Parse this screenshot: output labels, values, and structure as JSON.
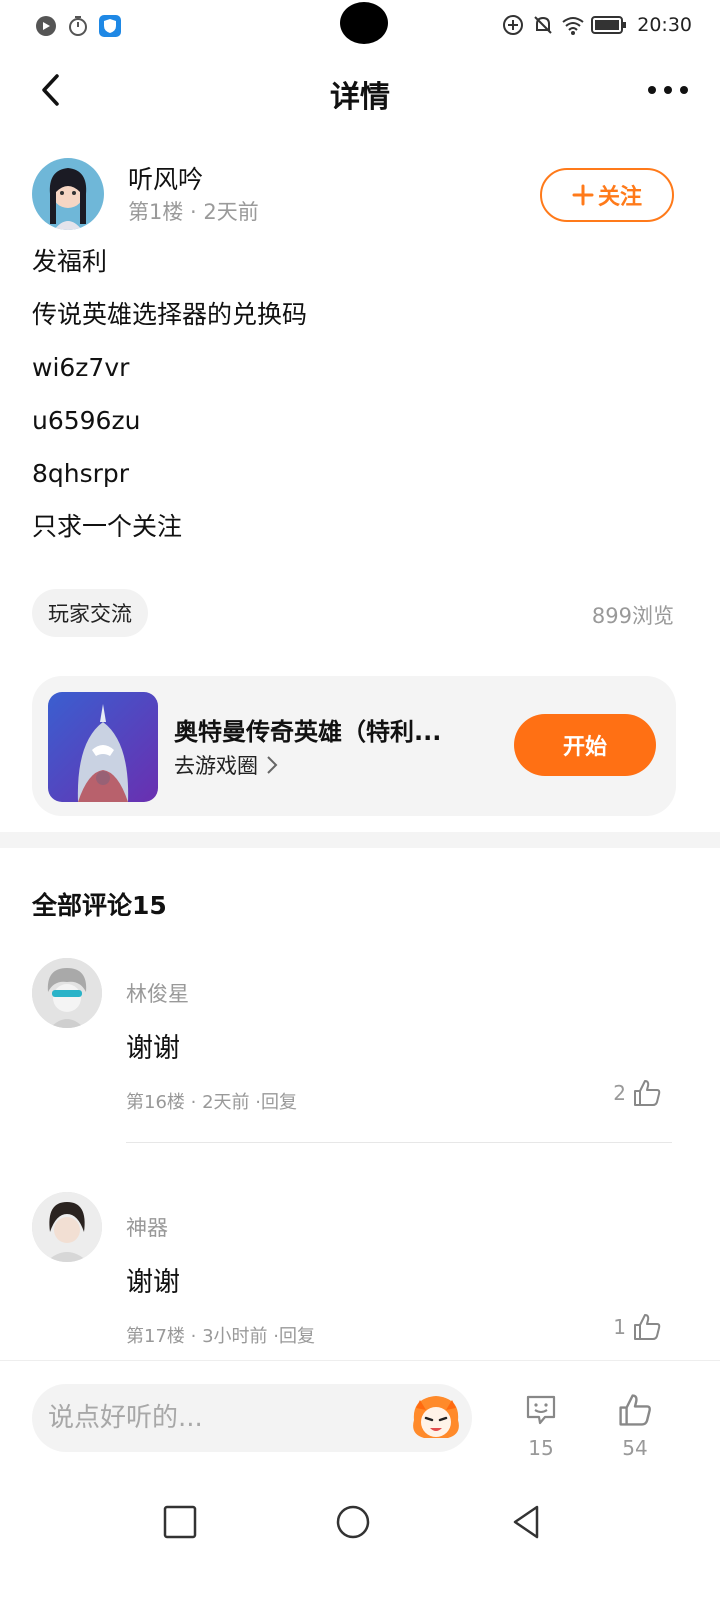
{
  "status_bar": {
    "time": "20:30"
  },
  "header": {
    "title": "详情"
  },
  "post": {
    "author_name": "听风吟",
    "meta": "第1楼 · 2天前",
    "follow_label": "关注",
    "lines": [
      "发福利",
      "传说英雄选择器的兑换码",
      "wi6z7vr",
      "u6596zu",
      "8qhsrpr",
      "只求一个关注"
    ],
    "tag": "玩家交流",
    "views": "899浏览"
  },
  "game": {
    "name": "奥特曼传奇英雄（特利...",
    "link_label": "去游戏圈",
    "start_label": "开始"
  },
  "comments": {
    "title": "全部评论15",
    "items": [
      {
        "name": "林俊星",
        "text": "谢谢",
        "meta": "第16楼 · 2天前 ·回复",
        "likes": "2"
      },
      {
        "name": "神器",
        "text": "谢谢",
        "meta": "第17楼 · 3小时前 ·回复",
        "likes": "1"
      }
    ]
  },
  "bottom_bar": {
    "input_placeholder": "说点好听的...",
    "comment_count": "15",
    "like_count": "54"
  },
  "colors": {
    "accent": "#ff7014",
    "muted": "#999999"
  }
}
